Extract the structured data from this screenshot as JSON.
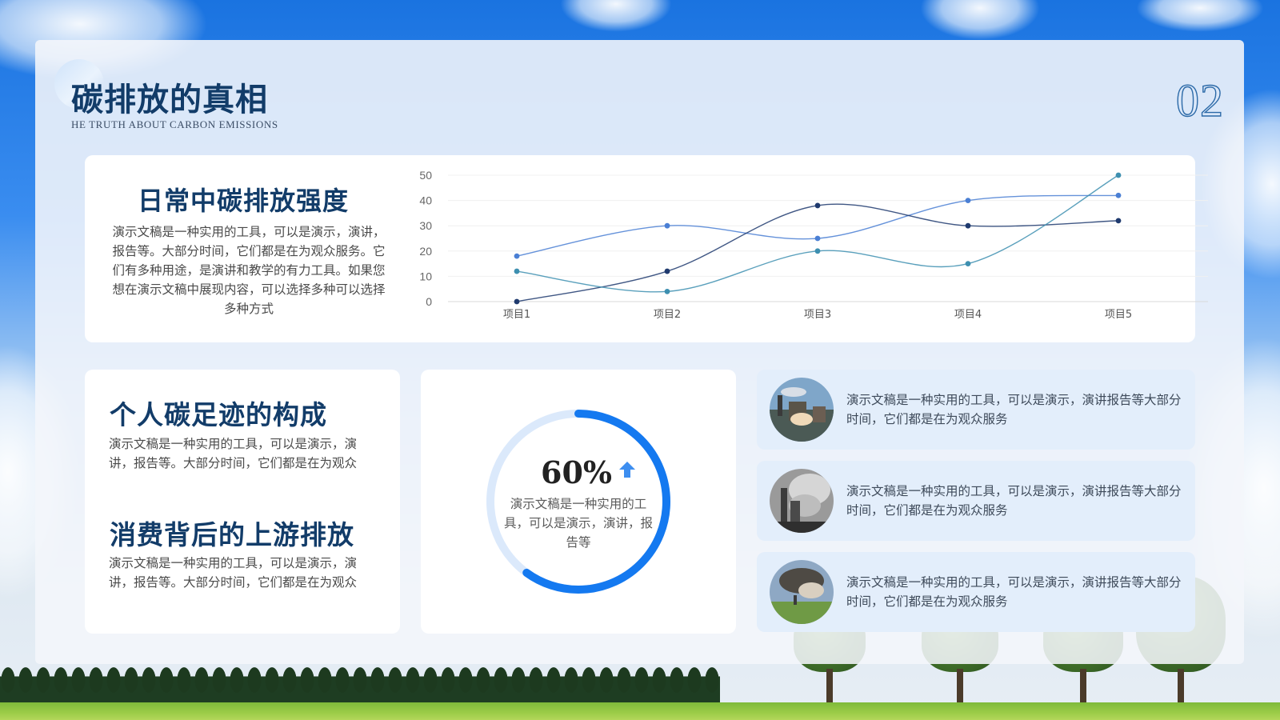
{
  "header": {
    "title": "碳排放的真相",
    "subtitle": "HE TRUTH  ABOUT CARBON EMISSIONS",
    "page_number": "02"
  },
  "chart_section": {
    "heading": "日常中碳排放强度",
    "description": "演示文稿是一种实用的工具，可以是演示，演讲，报告等。大部分时间，它们都是在为观众服务。它们有多种用途，是演讲和教学的有力工具。如果您想在演示文稿中展现内容，可以选择多种可以选择多种方式"
  },
  "chart_data": {
    "type": "line",
    "categories": [
      "项目1",
      "项目2",
      "项目3",
      "项目4",
      "项目5"
    ],
    "ylim": [
      0,
      50
    ],
    "yticks": [
      0,
      10,
      20,
      30,
      40,
      50
    ],
    "grid": true,
    "smooth": true,
    "series": [
      {
        "values": [
          18,
          30,
          25,
          40,
          42
        ],
        "color": "#4a7fd4"
      },
      {
        "values": [
          0,
          12,
          38,
          30,
          32
        ],
        "color": "#1f3a6e"
      },
      {
        "values": [
          12,
          4,
          20,
          15,
          50
        ],
        "color": "#3d8fb0"
      }
    ]
  },
  "left_card": {
    "heading1": "个人碳足迹的构成",
    "text1": "演示文稿是一种实用的工具，可以是演示，演讲，报告等。大部分时间，它们都是在为观众",
    "heading2": "消费背后的上游排放",
    "text2": "演示文稿是一种实用的工具，可以是演示，演讲，报告等。大部分时间，它们都是在为观众"
  },
  "donut": {
    "value_label": "60%",
    "value": 0.6,
    "text": "演示文稿是一种实用的工具，可以是演示，演讲，报告等",
    "colors": {
      "fill": "#1479f0",
      "track": "#dbe9fb",
      "arrow": "#3d8ef0"
    }
  },
  "info_rows": [
    {
      "text": "演示文稿是一种实用的工具，可以是演示，演讲报告等大部分时间，它们都是在为观众服务",
      "icon": "factory-smoke-photo"
    },
    {
      "text": "演示文稿是一种实用的工具，可以是演示，演讲报告等大部分时间，它们都是在为观众服务",
      "icon": "power-plant-photo"
    },
    {
      "text": "演示文稿是一种实用的工具，可以是演示，演讲报告等大部分时间，它们都是在为观众服务",
      "icon": "pollution-field-photo"
    }
  ],
  "colors": {
    "title": "#123c69",
    "accent": "#1479f0",
    "info_bg": "#e3eefb"
  }
}
